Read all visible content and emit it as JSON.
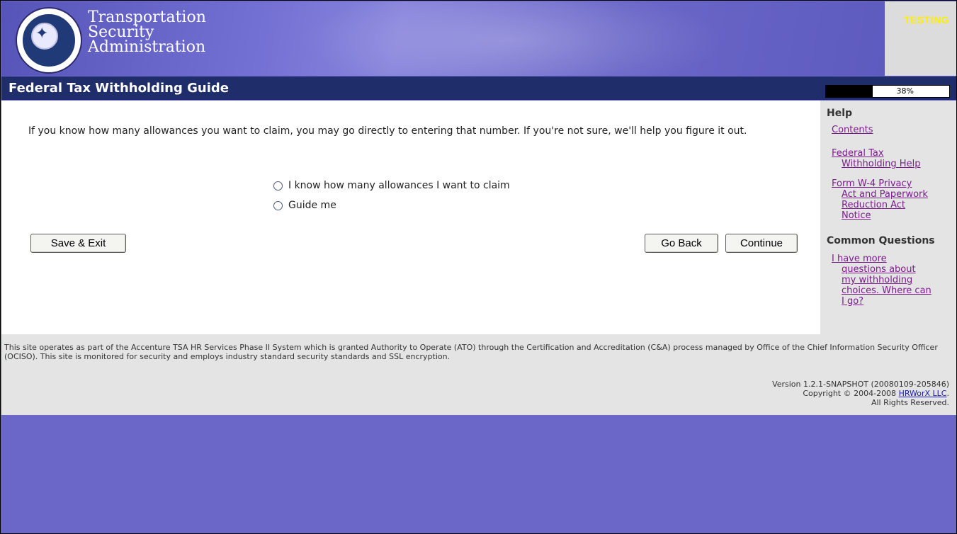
{
  "header": {
    "agency_line1": "Transportation",
    "agency_line2": "Security",
    "agency_line3": "Administration",
    "env_label": "TESTING"
  },
  "titlebar": {
    "title": "Federal Tax Withholding Guide",
    "progress_label": "38%",
    "progress_value": 0.38
  },
  "main": {
    "intro": "If you know how many allowances you want to claim, you may go directly to entering that number. If you're not sure, we'll help you figure it out.",
    "options": [
      {
        "label": "I know how many allowances I want to claim",
        "selected": false
      },
      {
        "label": "Guide me",
        "selected": false
      }
    ],
    "buttons": {
      "save_exit": "Save & Exit",
      "go_back": "Go Back",
      "continue": "Continue"
    }
  },
  "help": {
    "heading": "Help",
    "contents": "Contents",
    "fed_tax_line1": "Federal Tax",
    "fed_tax_line2": "Withholding Help",
    "w4_line1": "Form W-4 Privacy",
    "w4_line2": "Act and Paperwork",
    "w4_line3": "Reduction Act",
    "w4_line4": "Notice",
    "common_heading": "Common Questions",
    "cq_line1": "I have more",
    "cq_line2": "questions about",
    "cq_line3": "my withholding",
    "cq_line4": "choices. Where can",
    "cq_line5": "I go?"
  },
  "footer": {
    "ato": "This site operates as part of the Accenture TSA HR Services Phase II System which is granted Authority to Operate (ATO) through the Certification and Accreditation (C&A) process managed by Office of the Chief Information Security Officer (OCISO). This site is monitored for security and employs industry standard security standards and SSL encryption.",
    "version": "Version 1.2.1-SNAPSHOT (20080109-205846)",
    "copyright_prefix": "Copyright © 2004-2008 ",
    "company_link": "HRWorX LLC",
    "copyright_suffix": ".",
    "rights": "All Rights Reserved."
  },
  "colors": {
    "page_bg": "#6a67c8",
    "titlebar_bg": "#1f2d6b",
    "link": "#7a1c8c",
    "testing": "#ffee00"
  }
}
